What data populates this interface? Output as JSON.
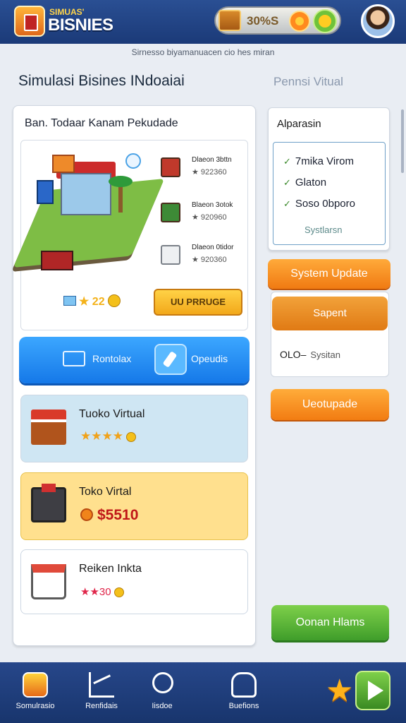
{
  "header": {
    "brand_top": "SIMUAS'",
    "brand": "BISNIES",
    "coin_value": "30%S",
    "avatar_alt": "user avatar"
  },
  "subnote": "Sirnesso biyamanuacen cio hes miran",
  "page_title": "Simulasi Bisines INdoaiai",
  "tab_virtual": "Pennsi Vitual",
  "left_panel": {
    "title": "Ban. Todaar Kanam Pekudade",
    "scene_items": [
      {
        "name": "Dlaeon 3bttn",
        "price": "★ 922360"
      },
      {
        "name": "Blaeon 3otok",
        "price": "★ 920960"
      },
      {
        "name": "Dlaeon 0tidor",
        "price": "★ 920360"
      }
    ],
    "scene_stats": "★ 22",
    "scene_button": "UU PRRUGE",
    "blue_bar": {
      "left_label": "Rontolax",
      "right_label": "Opeudis"
    },
    "cards": [
      {
        "title": "Tuoko Virtual",
        "rating": "★★★★"
      },
      {
        "title": "Toko Virtal",
        "price": "$5510"
      },
      {
        "title": "Reiken Inkta",
        "rating": "★★30"
      }
    ]
  },
  "right_panel": {
    "title": "Alparasin",
    "checklist": [
      "7mika Virom",
      "Glaton",
      "Soso 0bporo"
    ],
    "sub_label": "Systlarsn",
    "system_update": "System Update",
    "sapent": "Sapent",
    "signature": "OLO–",
    "signature_label": "Sysitan",
    "upgrade": "Ueotupade",
    "green_button": "Oonan Hlams"
  },
  "bottom_nav": [
    {
      "label": "Somulrasio",
      "icon": "home-icon"
    },
    {
      "label": "Renfidais",
      "icon": "chart-icon"
    },
    {
      "label": "Iisdoe",
      "icon": "search-icon"
    },
    {
      "label": "Buefions",
      "icon": "bot-icon"
    }
  ],
  "colors": {
    "header_bg": "#1b3a78",
    "accent_orange": "#f07a12",
    "accent_blue": "#1578e8",
    "accent_green": "#3f9d2a"
  }
}
